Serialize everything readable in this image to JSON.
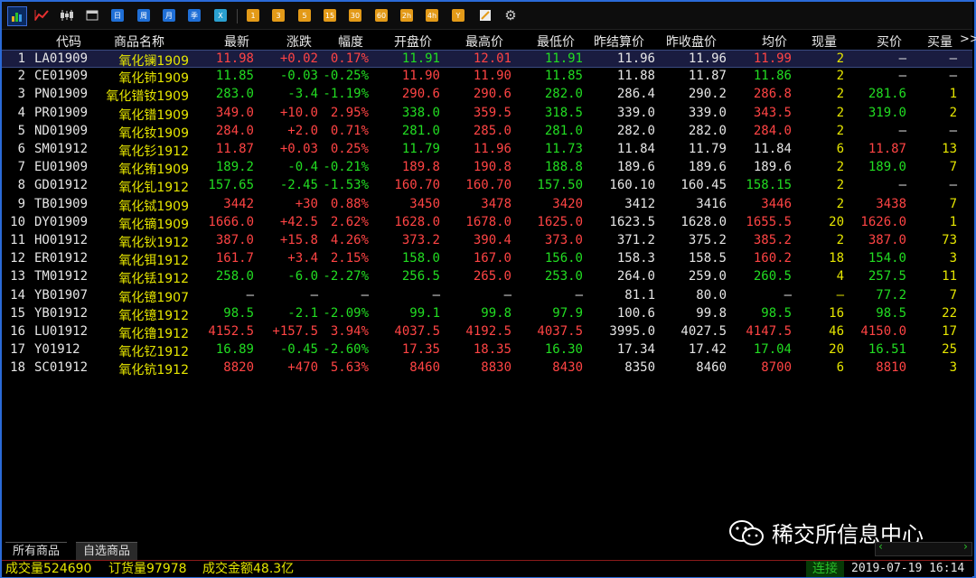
{
  "toolbar": {
    "period_buttons": [
      "日",
      "周",
      "月",
      "季",
      "X"
    ],
    "interval_buttons": [
      "1",
      "3",
      "5",
      "15",
      "30",
      "60",
      "2h",
      "4h",
      "Y"
    ]
  },
  "columns": [
    "代码",
    "商品名称",
    "最新",
    "涨跌",
    "幅度",
    "开盘价",
    "最高价",
    "最低价",
    "昨结算价",
    "昨收盘价",
    "均价",
    "现量",
    "买价",
    "买量",
    ">>"
  ],
  "rows": [
    {
      "n": "1",
      "code": "LA01909",
      "name": "氧化镧1909",
      "last": "11.98",
      "chg": "+0.02",
      "pct": "0.17%",
      "open": "11.91",
      "high": "12.01",
      "low": "11.91",
      "pset": "11.96",
      "pclose": "11.96",
      "avg": "11.99",
      "vol": "2",
      "bid": "—",
      "bidv": "—",
      "cl": {
        "last": "red",
        "chg": "red",
        "pct": "red",
        "open": "grn",
        "high": "red",
        "low": "grn",
        "avg": "red",
        "bid": "wht",
        "bidv": "wht"
      }
    },
    {
      "n": "2",
      "code": "CE01909",
      "name": "氧化铈1909",
      "last": "11.85",
      "chg": "-0.03",
      "pct": "-0.25%",
      "open": "11.90",
      "high": "11.90",
      "low": "11.85",
      "pset": "11.88",
      "pclose": "11.87",
      "avg": "11.86",
      "vol": "2",
      "bid": "—",
      "bidv": "—",
      "cl": {
        "last": "grn",
        "chg": "grn",
        "pct": "grn",
        "open": "red",
        "high": "red",
        "low": "grn",
        "avg": "grn",
        "bid": "wht",
        "bidv": "wht"
      }
    },
    {
      "n": "3",
      "code": "PN01909",
      "name": "氧化镨钕1909",
      "last": "283.0",
      "chg": "-3.4",
      "pct": "-1.19%",
      "open": "290.6",
      "high": "290.6",
      "low": "282.0",
      "pset": "286.4",
      "pclose": "290.2",
      "avg": "286.8",
      "vol": "2",
      "bid": "281.6",
      "bidv": "1",
      "cl": {
        "last": "grn",
        "chg": "grn",
        "pct": "grn",
        "open": "red",
        "high": "red",
        "low": "grn",
        "avg": "red",
        "bid": "grn",
        "bidv": "yel"
      }
    },
    {
      "n": "4",
      "code": "PR01909",
      "name": "氧化镨1909",
      "last": "349.0",
      "chg": "+10.0",
      "pct": "2.95%",
      "open": "338.0",
      "high": "359.5",
      "low": "318.5",
      "pset": "339.0",
      "pclose": "339.0",
      "avg": "343.5",
      "vol": "2",
      "bid": "319.0",
      "bidv": "2",
      "cl": {
        "last": "red",
        "chg": "red",
        "pct": "red",
        "open": "grn",
        "high": "red",
        "low": "grn",
        "avg": "red",
        "bid": "grn",
        "bidv": "yel"
      }
    },
    {
      "n": "5",
      "code": "ND01909",
      "name": "氧化钕1909",
      "last": "284.0",
      "chg": "+2.0",
      "pct": "0.71%",
      "open": "281.0",
      "high": "285.0",
      "low": "281.0",
      "pset": "282.0",
      "pclose": "282.0",
      "avg": "284.0",
      "vol": "2",
      "bid": "—",
      "bidv": "—",
      "cl": {
        "last": "red",
        "chg": "red",
        "pct": "red",
        "open": "grn",
        "high": "red",
        "low": "grn",
        "avg": "red",
        "bid": "wht",
        "bidv": "wht"
      }
    },
    {
      "n": "6",
      "code": "SM01912",
      "name": "氧化钐1912",
      "last": "11.87",
      "chg": "+0.03",
      "pct": "0.25%",
      "open": "11.79",
      "high": "11.96",
      "low": "11.73",
      "pset": "11.84",
      "pclose": "11.79",
      "avg": "11.84",
      "vol": "6",
      "bid": "11.87",
      "bidv": "13",
      "cl": {
        "last": "red",
        "chg": "red",
        "pct": "red",
        "open": "grn",
        "high": "red",
        "low": "grn",
        "avg": "wht",
        "bid": "red",
        "bidv": "yel"
      }
    },
    {
      "n": "7",
      "code": "EU01909",
      "name": "氧化铕1909",
      "last": "189.2",
      "chg": "-0.4",
      "pct": "-0.21%",
      "open": "189.8",
      "high": "190.8",
      "low": "188.8",
      "pset": "189.6",
      "pclose": "189.6",
      "avg": "189.6",
      "vol": "2",
      "bid": "189.0",
      "bidv": "7",
      "cl": {
        "last": "grn",
        "chg": "grn",
        "pct": "grn",
        "open": "red",
        "high": "red",
        "low": "grn",
        "avg": "wht",
        "bid": "grn",
        "bidv": "yel"
      }
    },
    {
      "n": "8",
      "code": "GD01912",
      "name": "氧化钆1912",
      "last": "157.65",
      "chg": "-2.45",
      "pct": "-1.53%",
      "open": "160.70",
      "high": "160.70",
      "low": "157.50",
      "pset": "160.10",
      "pclose": "160.45",
      "avg": "158.15",
      "vol": "2",
      "bid": "—",
      "bidv": "—",
      "cl": {
        "last": "grn",
        "chg": "grn",
        "pct": "grn",
        "open": "red",
        "high": "red",
        "low": "grn",
        "avg": "grn",
        "bid": "wht",
        "bidv": "wht"
      }
    },
    {
      "n": "9",
      "code": "TB01909",
      "name": "氧化铽1909",
      "last": "3442",
      "chg": "+30",
      "pct": "0.88%",
      "open": "3450",
      "high": "3478",
      "low": "3420",
      "pset": "3412",
      "pclose": "3416",
      "avg": "3446",
      "vol": "2",
      "bid": "3438",
      "bidv": "7",
      "cl": {
        "last": "red",
        "chg": "red",
        "pct": "red",
        "open": "red",
        "high": "red",
        "low": "red",
        "avg": "red",
        "bid": "red",
        "bidv": "yel"
      }
    },
    {
      "n": "10",
      "code": "DY01909",
      "name": "氧化镝1909",
      "last": "1666.0",
      "chg": "+42.5",
      "pct": "2.62%",
      "open": "1628.0",
      "high": "1678.0",
      "low": "1625.0",
      "pset": "1623.5",
      "pclose": "1628.0",
      "avg": "1655.5",
      "vol": "20",
      "bid": "1626.0",
      "bidv": "1",
      "cl": {
        "last": "red",
        "chg": "red",
        "pct": "red",
        "open": "red",
        "high": "red",
        "low": "red",
        "avg": "red",
        "bid": "red",
        "bidv": "yel"
      }
    },
    {
      "n": "11",
      "code": "HO01912",
      "name": "氧化钬1912",
      "last": "387.0",
      "chg": "+15.8",
      "pct": "4.26%",
      "open": "373.2",
      "high": "390.4",
      "low": "373.0",
      "pset": "371.2",
      "pclose": "375.2",
      "avg": "385.2",
      "vol": "2",
      "bid": "387.0",
      "bidv": "73",
      "cl": {
        "last": "red",
        "chg": "red",
        "pct": "red",
        "open": "red",
        "high": "red",
        "low": "red",
        "avg": "red",
        "bid": "red",
        "bidv": "yel"
      }
    },
    {
      "n": "12",
      "code": "ER01912",
      "name": "氧化铒1912",
      "last": "161.7",
      "chg": "+3.4",
      "pct": "2.15%",
      "open": "158.0",
      "high": "167.0",
      "low": "156.0",
      "pset": "158.3",
      "pclose": "158.5",
      "avg": "160.2",
      "vol": "18",
      "bid": "154.0",
      "bidv": "3",
      "cl": {
        "last": "red",
        "chg": "red",
        "pct": "red",
        "open": "grn",
        "high": "red",
        "low": "grn",
        "avg": "red",
        "bid": "grn",
        "bidv": "yel"
      }
    },
    {
      "n": "13",
      "code": "TM01912",
      "name": "氧化铥1912",
      "last": "258.0",
      "chg": "-6.0",
      "pct": "-2.27%",
      "open": "256.5",
      "high": "265.0",
      "low": "253.0",
      "pset": "264.0",
      "pclose": "259.0",
      "avg": "260.5",
      "vol": "4",
      "bid": "257.5",
      "bidv": "11",
      "cl": {
        "last": "grn",
        "chg": "grn",
        "pct": "grn",
        "open": "grn",
        "high": "red",
        "low": "grn",
        "avg": "grn",
        "bid": "grn",
        "bidv": "yel"
      }
    },
    {
      "n": "14",
      "code": "YB01907",
      "name": "氧化镱1907",
      "last": "—",
      "chg": "—",
      "pct": "—",
      "open": "—",
      "high": "—",
      "low": "—",
      "pset": "81.1",
      "pclose": "80.0",
      "avg": "—",
      "vol": "—",
      "bid": "77.2",
      "bidv": "7",
      "cl": {
        "last": "wht",
        "chg": "wht",
        "pct": "wht",
        "open": "wht",
        "high": "wht",
        "low": "wht",
        "avg": "wht",
        "bid": "grn",
        "bidv": "yel"
      }
    },
    {
      "n": "15",
      "code": "YB01912",
      "name": "氧化镱1912",
      "last": "98.5",
      "chg": "-2.1",
      "pct": "-2.09%",
      "open": "99.1",
      "high": "99.8",
      "low": "97.9",
      "pset": "100.6",
      "pclose": "99.8",
      "avg": "98.5",
      "vol": "16",
      "bid": "98.5",
      "bidv": "22",
      "cl": {
        "last": "grn",
        "chg": "grn",
        "pct": "grn",
        "open": "grn",
        "high": "grn",
        "low": "grn",
        "avg": "grn",
        "bid": "grn",
        "bidv": "yel"
      }
    },
    {
      "n": "16",
      "code": "LU01912",
      "name": "氧化镥1912",
      "last": "4152.5",
      "chg": "+157.5",
      "pct": "3.94%",
      "open": "4037.5",
      "high": "4192.5",
      "low": "4037.5",
      "pset": "3995.0",
      "pclose": "4027.5",
      "avg": "4147.5",
      "vol": "46",
      "bid": "4150.0",
      "bidv": "17",
      "cl": {
        "last": "red",
        "chg": "red",
        "pct": "red",
        "open": "red",
        "high": "red",
        "low": "red",
        "avg": "red",
        "bid": "red",
        "bidv": "yel"
      }
    },
    {
      "n": "17",
      "code": "Y01912",
      "name": "氧化钇1912",
      "last": "16.89",
      "chg": "-0.45",
      "pct": "-2.60%",
      "open": "17.35",
      "high": "18.35",
      "low": "16.30",
      "pset": "17.34",
      "pclose": "17.42",
      "avg": "17.04",
      "vol": "20",
      "bid": "16.51",
      "bidv": "25",
      "cl": {
        "last": "grn",
        "chg": "grn",
        "pct": "grn",
        "open": "red",
        "high": "red",
        "low": "grn",
        "avg": "grn",
        "bid": "grn",
        "bidv": "yel"
      }
    },
    {
      "n": "18",
      "code": "SC01912",
      "name": "氧化钪1912",
      "last": "8820",
      "chg": "+470",
      "pct": "5.63%",
      "open": "8460",
      "high": "8830",
      "low": "8430",
      "pset": "8350",
      "pclose": "8460",
      "avg": "8700",
      "vol": "6",
      "bid": "8810",
      "bidv": "3",
      "cl": {
        "last": "red",
        "chg": "red",
        "pct": "red",
        "open": "red",
        "high": "red",
        "low": "red",
        "avg": "red",
        "bid": "red",
        "bidv": "yel"
      }
    }
  ],
  "tabs": {
    "all": "所有商品",
    "fav": "自选商品"
  },
  "status": {
    "volume": "成交量524690",
    "orders": "订货量97978",
    "amount": "成交金额48.3亿",
    "connection": "连接",
    "datetime": "2019-07-19 16:14"
  },
  "watermark": "稀交所信息中心",
  "colors": {
    "up": "#ff4444",
    "down": "#22dd22",
    "neutral": "#e6e6e6",
    "symbol": "#e6e600",
    "accent": "#2a6ad8"
  }
}
